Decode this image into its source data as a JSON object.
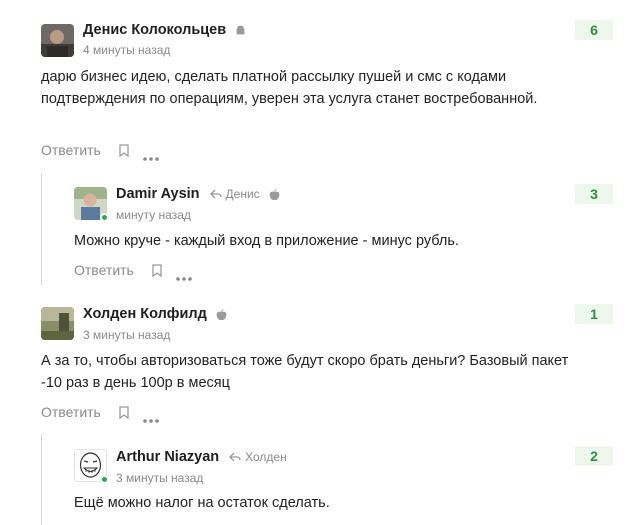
{
  "comments": [
    {
      "author": "Денис Колокольцев",
      "platform_icon": "android-icon",
      "time": "4 минуты назад",
      "text": "дарю бизнес идею, сделать платной рассылку пушей и смс с кодами подтверждения по операциям, уверен эта услуга станет востребованной.",
      "reply_label": "Ответить",
      "rating": "6"
    },
    {
      "author": "Damir Aysin",
      "reply_to": "Денис",
      "platform_icon": "apple-icon",
      "time": "минуту назад",
      "text": "Можно круче - каждый вход в приложение - минус рубль.",
      "reply_label": "Ответить",
      "rating": "3",
      "online": true
    },
    {
      "author": "Холден Колфилд",
      "platform_icon": "apple-icon",
      "time": "3 минуты назад",
      "text": "А за то, чтобы авторизоваться тоже будут скоро брать деньги? Базовый пакет -10 раз в день 100р в месяц",
      "reply_label": "Ответить",
      "rating": "1"
    },
    {
      "author": "Arthur Niazyan",
      "reply_to": "Холден",
      "time": "3 минуты назад",
      "text": "Ещё можно налог на остаток сделать.",
      "rating": "2",
      "online": true
    }
  ],
  "colors": {
    "rating_bg": "#eef7ec",
    "rating_text": "#2f8f3a",
    "online": "#2aa952",
    "muted": "#8a8a8a"
  }
}
